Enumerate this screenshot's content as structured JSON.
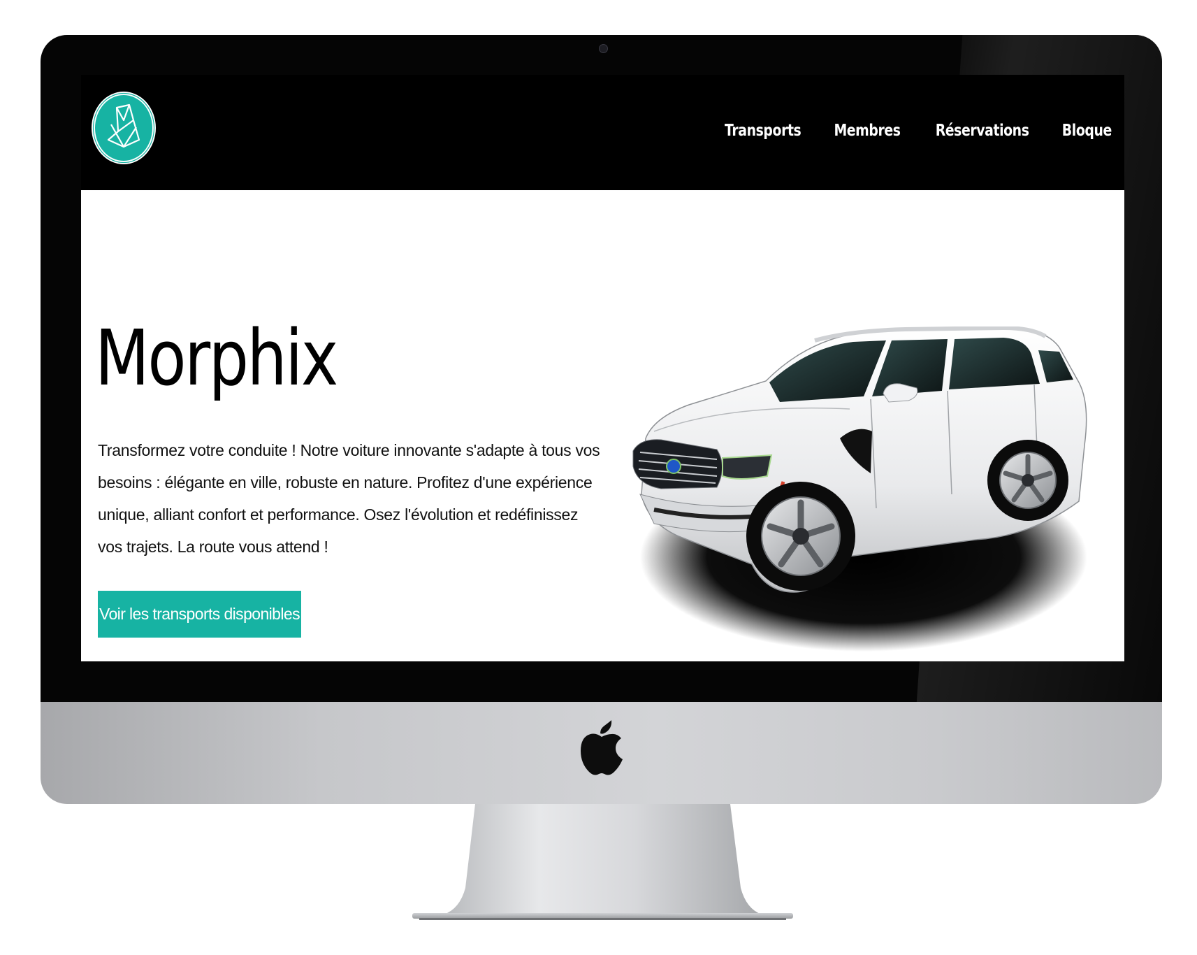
{
  "colors": {
    "accent": "#17b3a3",
    "header_bg": "#000000",
    "bezel": "#050505",
    "chin": "#c6c7ca"
  },
  "header": {
    "logo_icon": "morphix-circle-logo-icon",
    "nav": [
      {
        "label": "Transports"
      },
      {
        "label": "Membres"
      },
      {
        "label": "Réservations"
      },
      {
        "label": "Bloque"
      }
    ]
  },
  "hero": {
    "title": "Morphix",
    "description": "Transformez votre conduite ! Notre voiture innovante s'adapte à tous vos besoins : élégante en ville, robuste en nature. Profitez d'une expérience unique, alliant confort et performance. Osez l'évolution et redéfinissez vos trajets. La route vous attend !",
    "cta_label": "Voir les transports disponibles",
    "image_icon": "white-suv-car-image"
  },
  "device": {
    "brand_icon": "apple-logo-icon"
  }
}
